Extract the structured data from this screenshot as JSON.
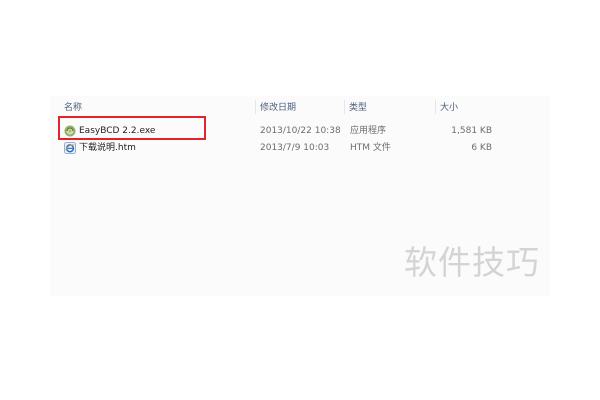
{
  "columns": {
    "name": "名称",
    "modified": "修改日期",
    "type": "类型",
    "size": "大小"
  },
  "files": [
    {
      "name": "EasyBCD 2.2.exe",
      "modified": "2013/10/22 10:38",
      "type": "应用程序",
      "size": "1,581 KB",
      "icon": "easybcd-app-icon"
    },
    {
      "name": "下载说明.htm",
      "modified": "2013/7/9 10:03",
      "type": "HTM 文件",
      "size": "6 KB",
      "icon": "ie-html-icon"
    }
  ],
  "highlight_color": "#e2232a",
  "watermark": "软件技巧"
}
